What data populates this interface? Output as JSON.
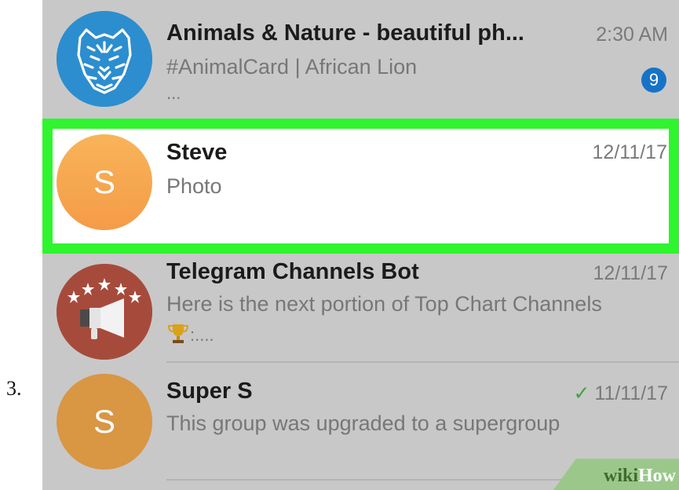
{
  "step": {
    "number": "3."
  },
  "chats": [
    {
      "name": "Animals & Nature - beautiful ph...",
      "preview_line1": "#AnimalCard | African Lion",
      "preview_line2": "...",
      "time": "2:30 AM",
      "unread": "9",
      "avatar_icon": "tiger-icon"
    },
    {
      "name": "Steve",
      "preview_line1": "Photo",
      "time": "12/11/17",
      "avatar_letter": "S"
    },
    {
      "name": "Telegram Channels Bot",
      "preview_line1": "Here is the next portion of Top Chart Channels",
      "preview_line2": ":....",
      "time": "12/11/17",
      "avatar_icon": "megaphone-icon",
      "trophy_icon": "trophy-icon"
    },
    {
      "name": "Super S",
      "preview_line1": "This group was upgraded to a supergroup",
      "time": "11/11/17",
      "avatar_letter": "S",
      "status_icon": "check-icon"
    }
  ],
  "watermark": {
    "wiki": "wiki",
    "how": "How"
  },
  "colors": {
    "highlight": "#2ff52f",
    "badge": "#1673c8",
    "list_background": "#c8c8c8",
    "avatar_tiger": "#2c8ecf",
    "avatar_steve": "#f5a54e",
    "avatar_bot": "#a64b3c",
    "avatar_supers": "#d99643"
  }
}
